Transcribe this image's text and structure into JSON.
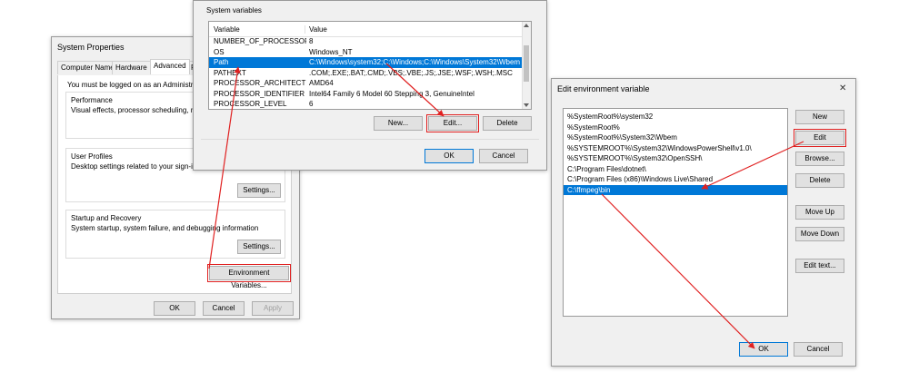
{
  "system_properties": {
    "title": "System Properties",
    "tabs": [
      "Computer Name",
      "Hardware",
      "Advanced",
      "Re"
    ],
    "admin_note": "You must be logged on as an Administrator t",
    "performance": {
      "title": "Performance",
      "desc": "Visual effects, processor scheduling, memo"
    },
    "user_profiles": {
      "title": "User Profiles",
      "desc": "Desktop settings related to your sign-in",
      "button": "Settings..."
    },
    "startup": {
      "title": "Startup and Recovery",
      "desc": "System startup, system failure, and debugging information",
      "button": "Settings..."
    },
    "env_button": "Environment Variables...",
    "ok": "OK",
    "cancel": "Cancel",
    "apply": "Apply"
  },
  "env_variables": {
    "section_title": "System variables",
    "columns": [
      "Variable",
      "Value"
    ],
    "rows": [
      {
        "name": "NUMBER_OF_PROCESSORS",
        "value": "8"
      },
      {
        "name": "OS",
        "value": "Windows_NT"
      },
      {
        "name": "Path",
        "value": "C:\\Windows\\system32;C:\\Windows;C:\\Windows\\System32\\Wbem;..."
      },
      {
        "name": "PATHEXT",
        "value": ".COM;.EXE;.BAT;.CMD;.VBS;.VBE;.JS;.JSE;.WSF;.WSH;.MSC"
      },
      {
        "name": "PROCESSOR_ARCHITECTURE",
        "value": "AMD64"
      },
      {
        "name": "PROCESSOR_IDENTIFIER",
        "value": "Intel64 Family 6 Model 60 Stepping 3, GenuineIntel"
      },
      {
        "name": "PROCESSOR_LEVEL",
        "value": "6"
      }
    ],
    "selected_index": 2,
    "new": "New...",
    "edit": "Edit...",
    "delete": "Delete",
    "ok": "OK",
    "cancel": "Cancel"
  },
  "edit_env": {
    "title": "Edit environment variable",
    "close": "✕",
    "items": [
      "%SystemRoot%\\system32",
      "%SystemRoot%",
      "%SystemRoot%\\System32\\Wbem",
      "%SYSTEMROOT%\\System32\\WindowsPowerShell\\v1.0\\",
      "%SYSTEMROOT%\\System32\\OpenSSH\\",
      "C:\\Program Files\\dotnet\\",
      "C:\\Program Files (x86)\\Windows Live\\Shared",
      "C:\\ffmpeg\\bin"
    ],
    "selected_index": 7,
    "buttons": {
      "new": "New",
      "edit": "Edit",
      "browse": "Browse...",
      "delete": "Delete",
      "move_up": "Move Up",
      "move_down": "Move Down",
      "edit_text": "Edit text..."
    },
    "ok": "OK",
    "cancel": "Cancel"
  },
  "colors": {
    "accent": "#0078d7",
    "highlight": "#e02020"
  }
}
